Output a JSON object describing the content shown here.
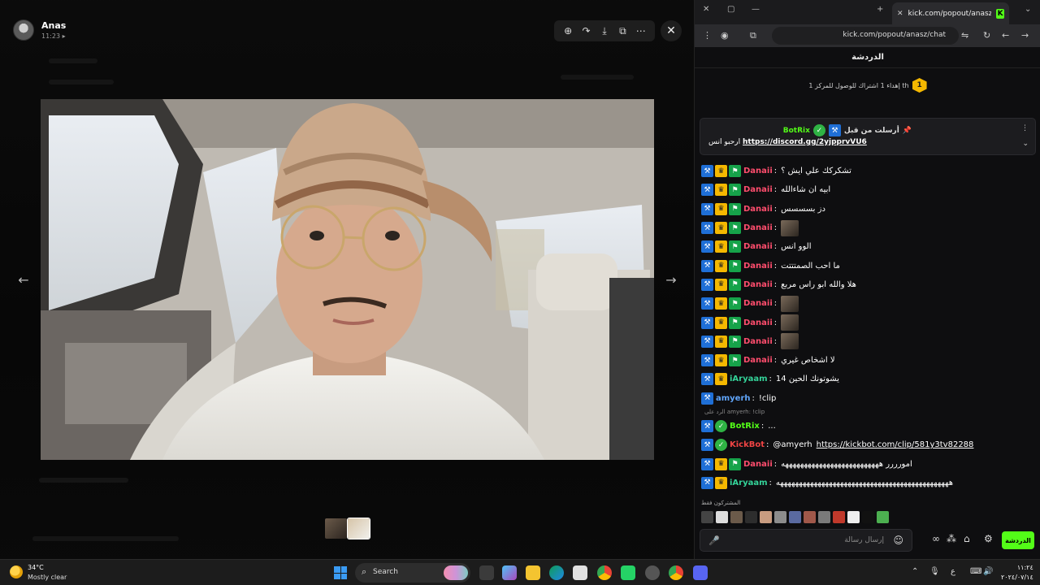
{
  "viewer": {
    "sender_name": "Anas",
    "sender_time": "11:23 ▸",
    "thumbnails": [
      "thumb-1",
      "thumb-2"
    ]
  },
  "browser": {
    "tab_title": "kick.com/popout/anasz/chat",
    "url": "kick.com/popout/anasz/chat"
  },
  "chat": {
    "title": "الدردشة",
    "goal_count": "1",
    "goal_text": "إهداء 1 اشتراك للوصول للمركز 1 th",
    "pinned": {
      "user": "BotRix",
      "label": "أرسلت من قبل",
      "body_text": "ارحبو انس",
      "link": "https://discord.gg/2yjpprvVU6"
    },
    "messages": [
      {
        "user": "Danaii",
        "text": "تشكركك علي ايش ؟"
      },
      {
        "user": "Danaii",
        "text": "ابيه ان شاءالله"
      },
      {
        "user": "Danaii",
        "text": "دز بسسسس"
      },
      {
        "user": "Danaii",
        "text": ""
      },
      {
        "user": "Danaii",
        "text": "الوو انس"
      },
      {
        "user": "Danaii",
        "text": "ما احب الصمتتتت"
      },
      {
        "user": "Danaii",
        "text": "هلا والله ابو راس مربع"
      },
      {
        "user": "Danaii",
        "text": ""
      },
      {
        "user": "Danaii",
        "text": ""
      },
      {
        "user": "Danaii",
        "text": ""
      },
      {
        "user": "Danaii",
        "text": "لا اشخاص غيري"
      },
      {
        "user": "iAryaam",
        "text": "يشوتونك الحين 14"
      },
      {
        "user": "amyerh",
        "text": "!clip"
      },
      {
        "user": "BotRix",
        "text": "..."
      },
      {
        "user": "KickBot",
        "text": "@amyerh",
        "link": "https://kickbot.com/clip/581y3tv82288"
      },
      {
        "user": "Danaii",
        "text": "امورررر ههههههههههههههههههههههههههه"
      },
      {
        "user": "iAryaam",
        "text": "ههههههههههههههههههههههههههههههههههههههههههههههه"
      }
    ],
    "reply_context": "الرد على amyerh: !clip",
    "subs_label": "المشتركون فقط",
    "input_placeholder": "إرسال رسالة",
    "send_label": "الدردشة"
  },
  "user_colors": {
    "Danaii": "#ff4d6d",
    "iAryaam": "#34d399",
    "amyerh": "#60a5fa",
    "BotRix": "#53fc18",
    "KickBot": "#ef4444"
  },
  "taskbar": {
    "weather_temp": "34°C",
    "weather_desc": "Mostly clear",
    "search_label": "Search",
    "clock_time": "١١:٢٤",
    "clock_date": "٢٠٢٤/٠٧/١٤"
  }
}
